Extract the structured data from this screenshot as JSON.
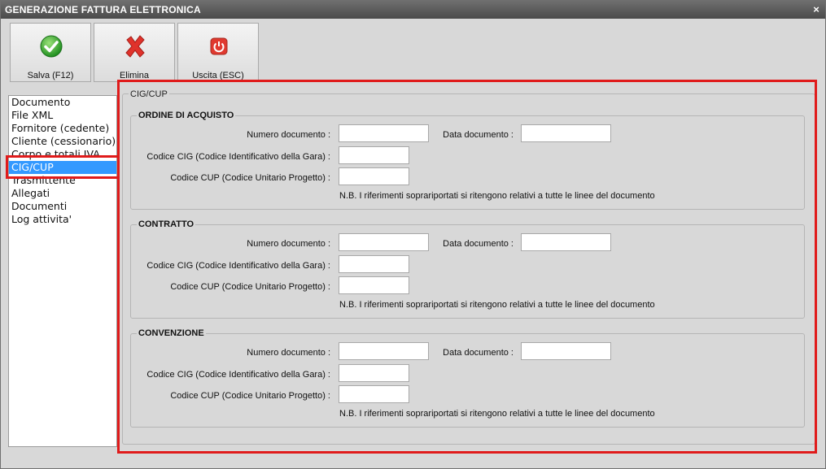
{
  "window": {
    "title": "GENERAZIONE FATTURA ELETTRONICA",
    "close_glyph": "×"
  },
  "toolbar": {
    "save_label": "Salva (F12)",
    "delete_label": "Elimina",
    "exit_label": "Uscita (ESC)",
    "save_icon": "checkmark-icon",
    "delete_icon": "red-x-icon",
    "exit_icon": "power-icon"
  },
  "nav": {
    "items": [
      {
        "label": "Documento"
      },
      {
        "label": "File XML"
      },
      {
        "label": "Fornitore (cedente)"
      },
      {
        "label": "Cliente (cessionario)"
      },
      {
        "label": "Corpo e totali IVA"
      },
      {
        "label": "CIG/CUP",
        "selected": true
      },
      {
        "label": "Trasmittente"
      },
      {
        "label": "Allegati"
      },
      {
        "label": "Documenti"
      },
      {
        "label": "Log attivita'"
      }
    ]
  },
  "panel": {
    "title": "CIG/CUP"
  },
  "sections": [
    {
      "title": "ORDINE DI ACQUISTO",
      "numero_label": "Numero documento :",
      "numero_value": "",
      "data_label": "Data documento :",
      "data_value": "",
      "cig_label": "Codice CIG (Codice Identificativo della Gara) :",
      "cig_value": "",
      "cup_label": "Codice CUP (Codice Unitario Progetto) :",
      "cup_value": "",
      "note": "N.B. I riferimenti soprariportati si ritengono relativi a tutte le linee del documento"
    },
    {
      "title": "CONTRATTO",
      "numero_label": "Numero documento :",
      "numero_value": "",
      "data_label": "Data documento :",
      "data_value": "",
      "cig_label": "Codice CIG (Codice Identificativo della Gara) :",
      "cig_value": "",
      "cup_label": "Codice CUP (Codice Unitario Progetto) :",
      "cup_value": "",
      "note": "N.B. I riferimenti soprariportati si ritengono relativi a tutte le linee del documento"
    },
    {
      "title": "CONVENZIONE",
      "numero_label": "Numero documento :",
      "numero_value": "",
      "data_label": "Data documento :",
      "data_value": "",
      "cig_label": "Codice CIG (Codice Identificativo della Gara) :",
      "cig_value": "",
      "cup_label": "Codice CUP (Codice Unitario Progetto) :",
      "cup_value": "",
      "note": "N.B. I riferimenti soprariportati si ritengono relativi a tutte le linee del documento"
    }
  ],
  "colors": {
    "highlight": "#e01b1b",
    "selection": "#3399ff",
    "titlebar": "#5a5a5a"
  }
}
